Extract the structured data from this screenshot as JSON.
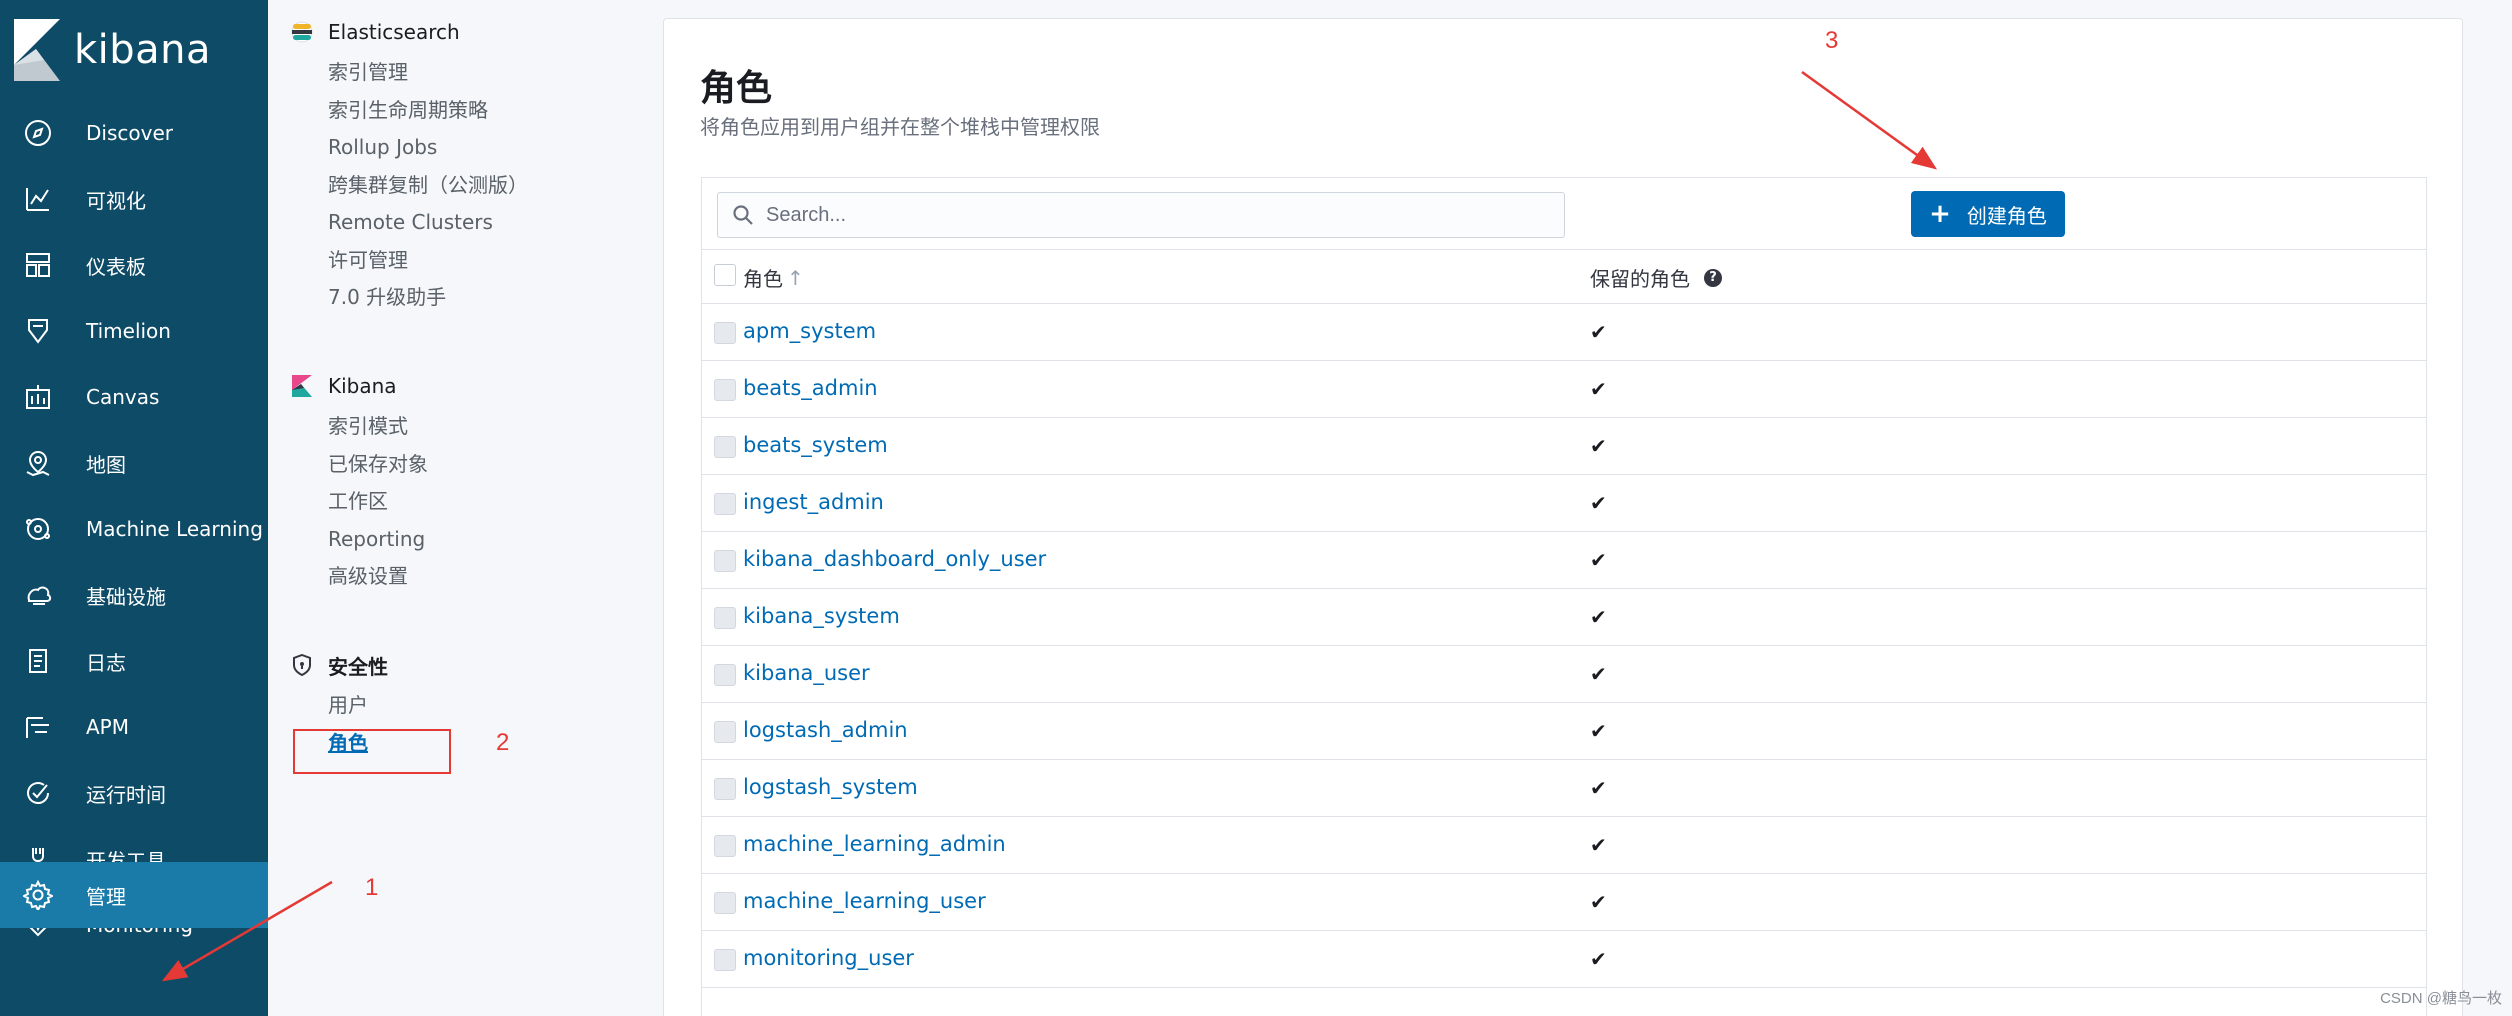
{
  "app": {
    "logo_text": "kibana"
  },
  "nav": {
    "items": [
      {
        "label": "Discover",
        "icon": "compass-icon"
      },
      {
        "label": "可视化",
        "icon": "visualize-icon"
      },
      {
        "label": "仪表板",
        "icon": "dashboard-icon"
      },
      {
        "label": "Timelion",
        "icon": "timelion-icon"
      },
      {
        "label": "Canvas",
        "icon": "canvas-icon"
      },
      {
        "label": "地图",
        "icon": "maps-icon"
      },
      {
        "label": "Machine Learning",
        "icon": "ml-icon"
      },
      {
        "label": "基础设施",
        "icon": "infrastructure-icon"
      },
      {
        "label": "日志",
        "icon": "logs-icon"
      },
      {
        "label": "APM",
        "icon": "apm-icon"
      },
      {
        "label": "运行时间",
        "icon": "uptime-icon"
      },
      {
        "label": "开发工具",
        "icon": "devtools-icon"
      },
      {
        "label": "Monitoring",
        "icon": "monitoring-icon"
      }
    ],
    "active_item": {
      "label": "管理",
      "icon": "gear-icon"
    }
  },
  "management": {
    "elasticsearch": {
      "heading": "Elasticsearch",
      "links": [
        "索引管理",
        "索引生命周期策略",
        "Rollup Jobs",
        "跨集群复制（公测版）",
        "Remote Clusters",
        "许可管理",
        "7.0 升级助手"
      ]
    },
    "kibana": {
      "heading": "Kibana",
      "links": [
        "索引模式",
        "已保存对象",
        "工作区",
        "Reporting",
        "高级设置"
      ]
    },
    "security": {
      "heading": "安全性",
      "links": [
        "用户",
        "角色"
      ],
      "selected": "角色"
    }
  },
  "page": {
    "title": "角色",
    "subtitle": "将角色应用到用户组并在整个堆栈中管理权限"
  },
  "search": {
    "placeholder": "Search..."
  },
  "create_button": {
    "label": "创建角色"
  },
  "table": {
    "columns": {
      "role": "角色",
      "sort_indicator": "↑",
      "reserved": "保留的角色"
    },
    "rows": [
      {
        "name": "apm_system",
        "reserved": "✔"
      },
      {
        "name": "beats_admin",
        "reserved": "✔"
      },
      {
        "name": "beats_system",
        "reserved": "✔"
      },
      {
        "name": "ingest_admin",
        "reserved": "✔"
      },
      {
        "name": "kibana_dashboard_only_user",
        "reserved": "✔"
      },
      {
        "name": "kibana_system",
        "reserved": "✔"
      },
      {
        "name": "kibana_user",
        "reserved": "✔"
      },
      {
        "name": "logstash_admin",
        "reserved": "✔"
      },
      {
        "name": "logstash_system",
        "reserved": "✔"
      },
      {
        "name": "machine_learning_admin",
        "reserved": "✔"
      },
      {
        "name": "machine_learning_user",
        "reserved": "✔"
      },
      {
        "name": "monitoring_user",
        "reserved": "✔"
      }
    ]
  },
  "annotations": {
    "one": "1",
    "two": "2",
    "three": "3",
    "color": "#e53935"
  },
  "watermark": "CSDN @糖鸟一枚"
}
